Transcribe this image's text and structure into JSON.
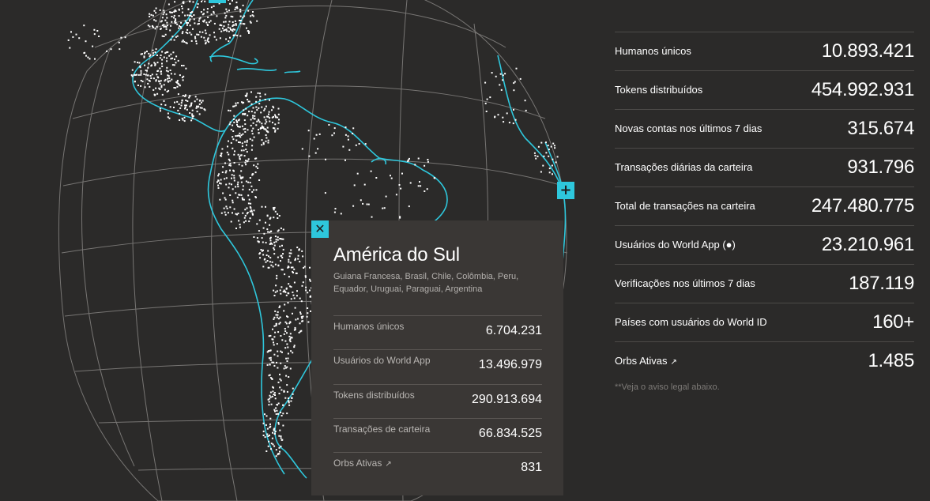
{
  "region": {
    "title": "América do Sul",
    "countries": "Guiana Francesa, Brasil, Chile, Colômbia, Peru, Equador, Uruguai, Paraguai, Argentina",
    "close_icon": "close-icon",
    "rows": [
      {
        "label": "Humanos únicos",
        "value": "6.704.231"
      },
      {
        "label": "Usuários do World App",
        "value": "13.496.979"
      },
      {
        "label": "Tokens distribuídos",
        "value": "290.913.694"
      },
      {
        "label": "Transações de carteira",
        "value": "66.834.525"
      },
      {
        "label": "Orbs Ativas",
        "value": "831",
        "icon": "arrow-up-right-icon"
      }
    ]
  },
  "stats": [
    {
      "label": "Humanos únicos",
      "value": "10.893.421"
    },
    {
      "label": "Tokens distribuídos",
      "value": "454.992.931"
    },
    {
      "label": "Novas contas nos últimos 7 dias",
      "value": "315.674"
    },
    {
      "label": "Transações diárias da carteira",
      "value": "931.796"
    },
    {
      "label": "Total de transações na carteira",
      "value": "247.480.775"
    },
    {
      "label": "Usuários do World App (●)",
      "value": "23.210.961"
    },
    {
      "label": "Verificações nos últimos 7 dias",
      "value": "187.119"
    },
    {
      "label": "Países com usuários do World ID",
      "value": "160+"
    },
    {
      "label": "Orbs Ativas",
      "value": "1.485",
      "icon": "arrow-up-right-icon"
    }
  ],
  "disclaimer": "**Veja o aviso legal abaixo.",
  "colors": {
    "background": "#2b2a29",
    "panel": "#3a3735",
    "accent": "#2ec7dc",
    "grid": "#8a8886",
    "dots": "#ffffff"
  },
  "globe_markers": {
    "expand_icon": "plus-icon"
  }
}
